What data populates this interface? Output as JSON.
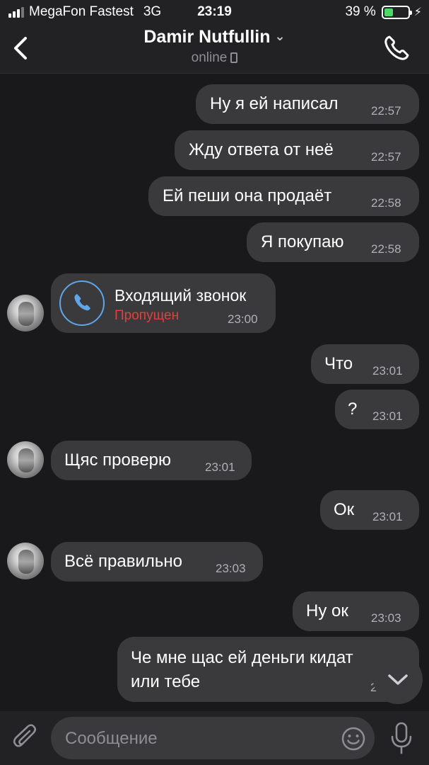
{
  "status_bar": {
    "carrier": "MegaFon Fastest",
    "network": "3G",
    "time": "23:19",
    "battery_percent": "39 %",
    "battery_level": 0.39
  },
  "header": {
    "contact_name": "Damir Nutfullin",
    "status": "online",
    "icons": [
      "back-chevron-icon",
      "chevron-down-icon",
      "mobile-device-icon",
      "phone-icon"
    ]
  },
  "messages": [
    {
      "side": "out",
      "text": "Ну я ей написал",
      "time": "22:57"
    },
    {
      "side": "out",
      "text": "Жду ответа от неё",
      "time": "22:57"
    },
    {
      "side": "out",
      "text": "Ей пеши она продаёт",
      "time": "22:58"
    },
    {
      "side": "out",
      "text": "Я покупаю",
      "time": "22:58"
    },
    {
      "side": "in",
      "type": "call",
      "title": "Входящий звонок",
      "status": "Пропущен",
      "time": "23:00"
    },
    {
      "side": "out",
      "text": "Что",
      "time": "23:01"
    },
    {
      "side": "out",
      "text": "?",
      "time": "23:01"
    },
    {
      "side": "in",
      "text": "Щяс проверю",
      "time": "23:01"
    },
    {
      "side": "out",
      "text": "Ок",
      "time": "23:01"
    },
    {
      "side": "in",
      "text": "Всё правильно",
      "time": "23:03"
    },
    {
      "side": "out",
      "text": "Ну ок",
      "time": "23:03"
    },
    {
      "side": "out",
      "text_line1": "Че мне щас ей деньги кидат",
      "text_line2": "или тебе",
      "time_partial": "2"
    }
  ],
  "colors": {
    "background": "#19191b",
    "bubble": "#3a3a3c",
    "bar": "#222224",
    "missed_call": "#e0413d",
    "call_icon": "#5ea6e8",
    "battery_fill": "#4cd964"
  },
  "input_bar": {
    "placeholder": "Сообщение",
    "icons": [
      "paperclip-icon",
      "emoji-icon",
      "microphone-icon"
    ]
  }
}
